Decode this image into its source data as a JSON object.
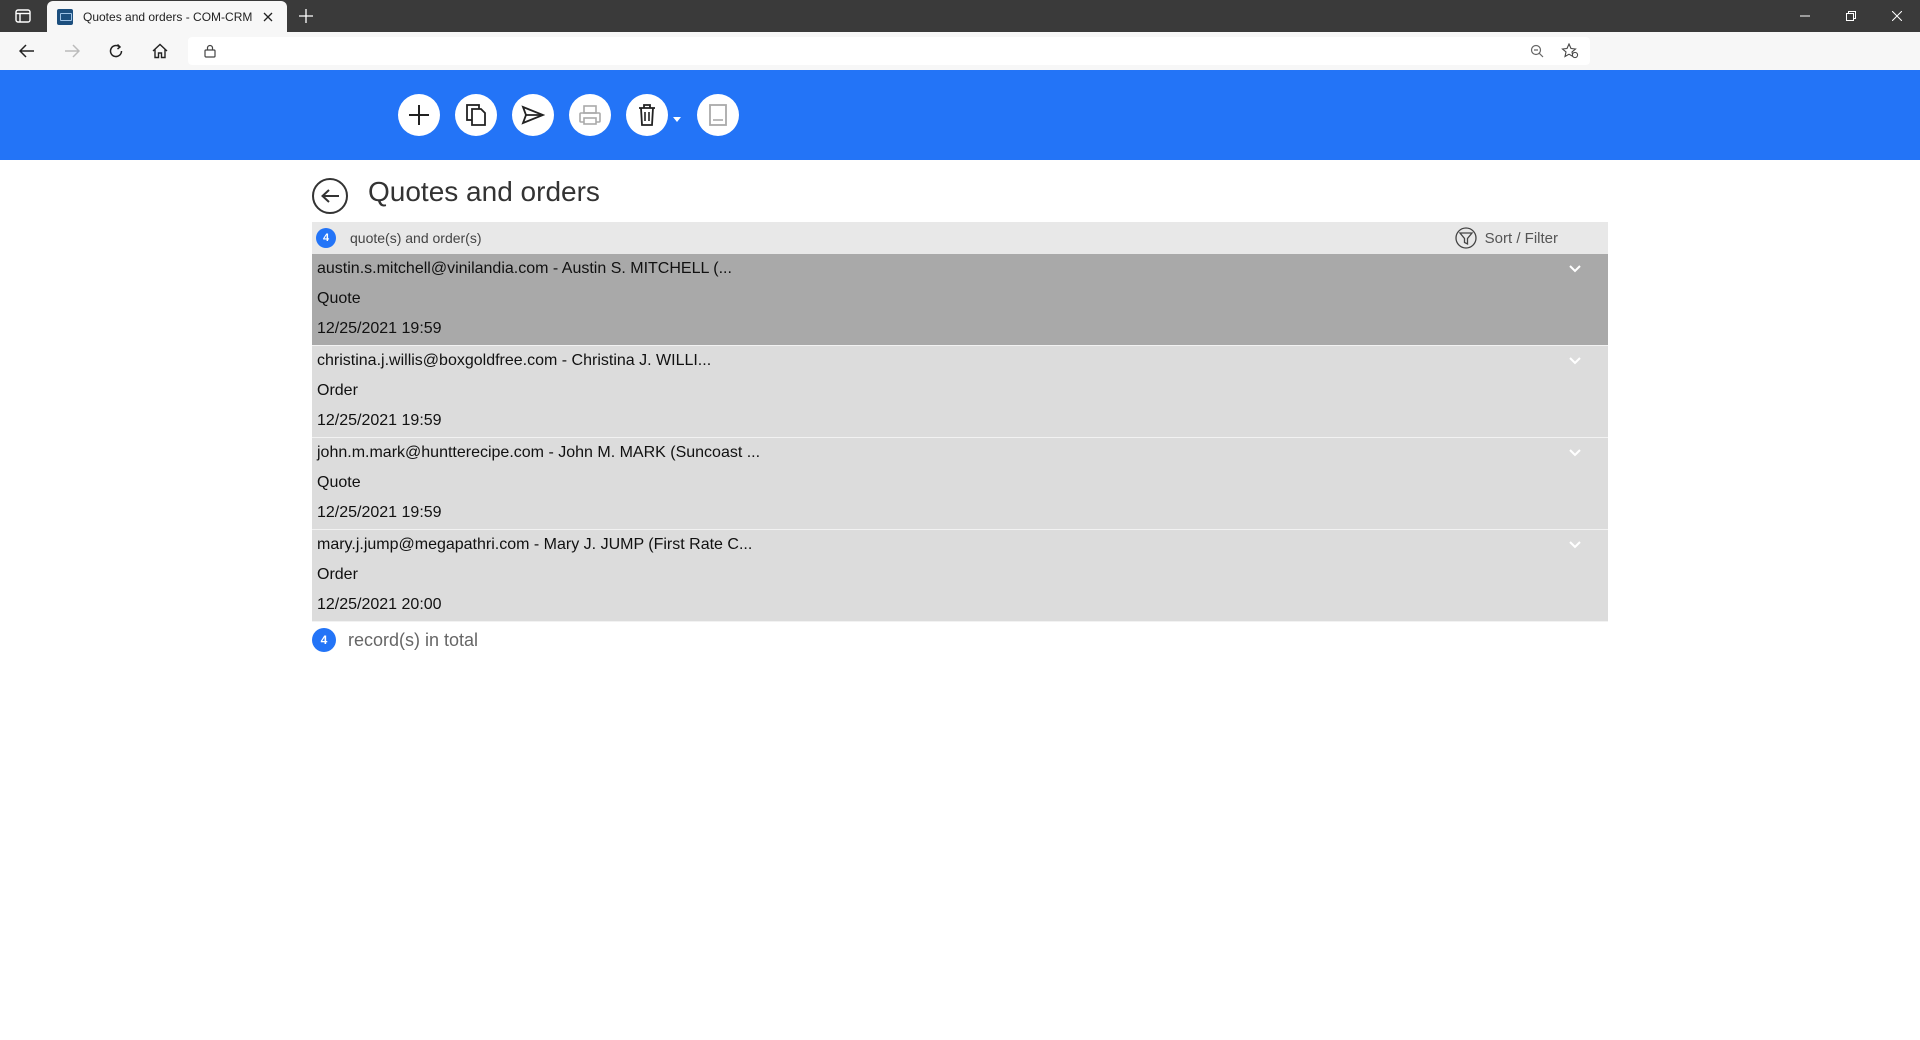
{
  "browser": {
    "tab_title": "Quotes and orders - COM-CRM"
  },
  "toolbar": {
    "icons": [
      "add-icon",
      "copy-icon",
      "send-icon",
      "print-icon",
      "delete-icon",
      "book-icon"
    ]
  },
  "page": {
    "title": "Quotes and orders"
  },
  "list": {
    "count": "4",
    "count_label": "quote(s) and order(s)",
    "sort_filter_label": "Sort / Filter",
    "records": [
      {
        "contact": "austin.s.mitchell@vinilandia.com - Austin S. MITCHELL (...",
        "type": "Quote",
        "datetime": "12/25/2021 19:59",
        "selected": true
      },
      {
        "contact": "christina.j.willis@boxgoldfree.com - Christina J. WILLI...",
        "type": "Order",
        "datetime": "12/25/2021 19:59",
        "selected": false
      },
      {
        "contact": "john.m.mark@huntterecipe.com - John M. MARK (Suncoast ...",
        "type": "Quote",
        "datetime": "12/25/2021 19:59",
        "selected": false
      },
      {
        "contact": "mary.j.jump@megapathri.com - Mary J. JUMP (First Rate C...",
        "type": "Order",
        "datetime": "12/25/2021 20:00",
        "selected": false
      }
    ]
  },
  "footer": {
    "total_count": "4",
    "total_label": "record(s) in total"
  },
  "colors": {
    "header_blue": "#2374f7",
    "selected_row": "#a9a9a9",
    "row": "#dcdcdc"
  }
}
